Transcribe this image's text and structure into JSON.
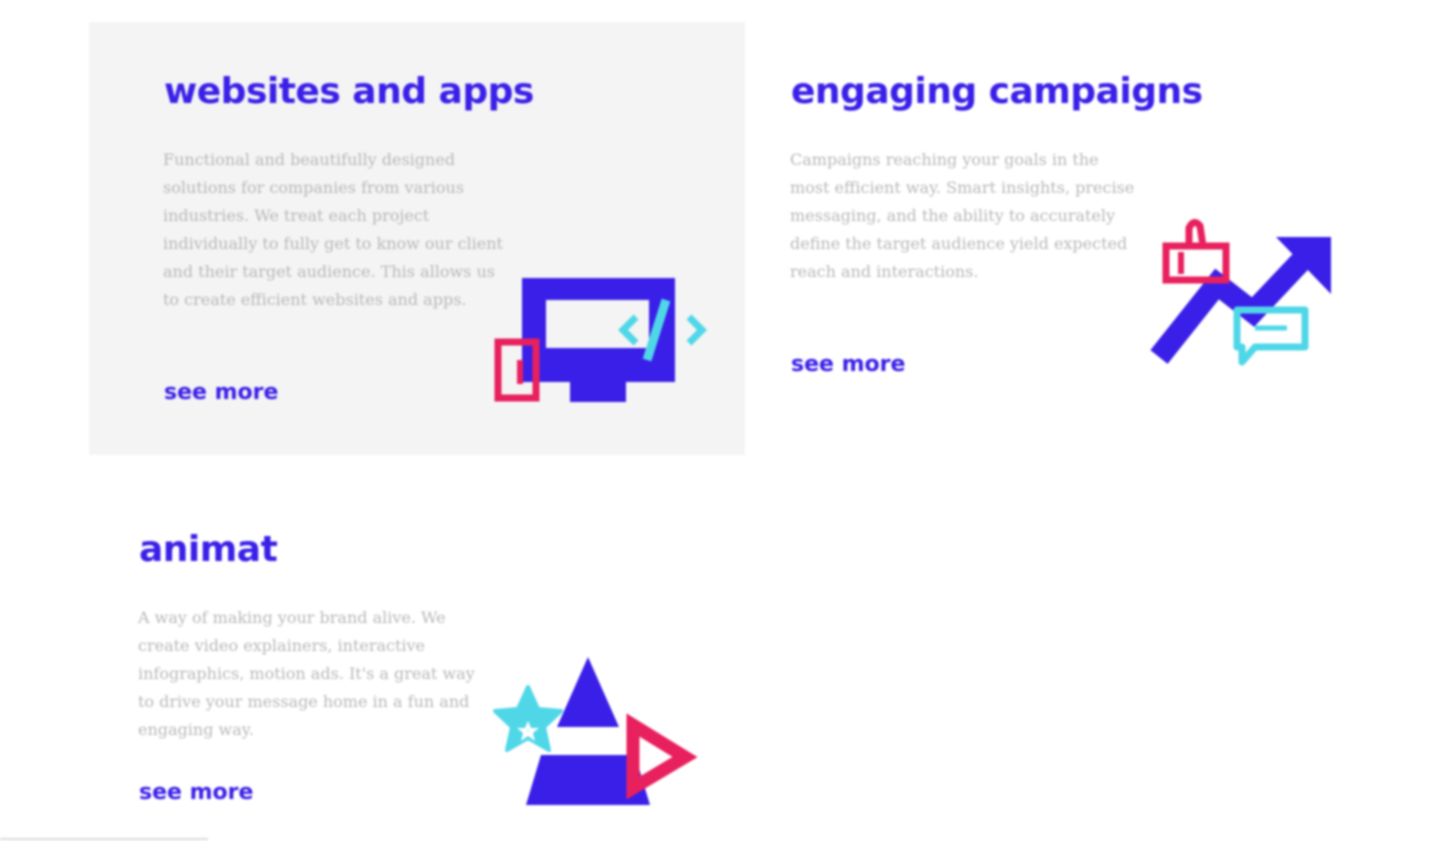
{
  "colors": {
    "primary": "#3a1fe8",
    "pink": "#e8205e",
    "cyan": "#4fd7e8",
    "card_bg": "#f4f4f4",
    "text_muted": "#b8b8b8"
  },
  "services": [
    {
      "title": "websites and apps",
      "description": "Functional and beautifully designed solutions for companies from various industries. We treat each project individually to fully get to know our client and their target audience. This allows us to create efficient websites and apps.",
      "link": "see more",
      "icon": "monitor-code-icon"
    },
    {
      "title": "engaging campaigns",
      "description": "Campaigns reaching your goals in the most efficient way. Smart insights, precise messaging, and the ability to accurately define the target audience yield expected reach and interactions.",
      "link": "see more",
      "icon": "growth-chart-icon"
    },
    {
      "title": "animat",
      "description": "A way of making your brand alive. We create video explainers, interactive infographics, motion ads. It's a great way to drive your message home in a fun and engaging way.",
      "link": "see more",
      "icon": "play-shapes-icon"
    }
  ]
}
